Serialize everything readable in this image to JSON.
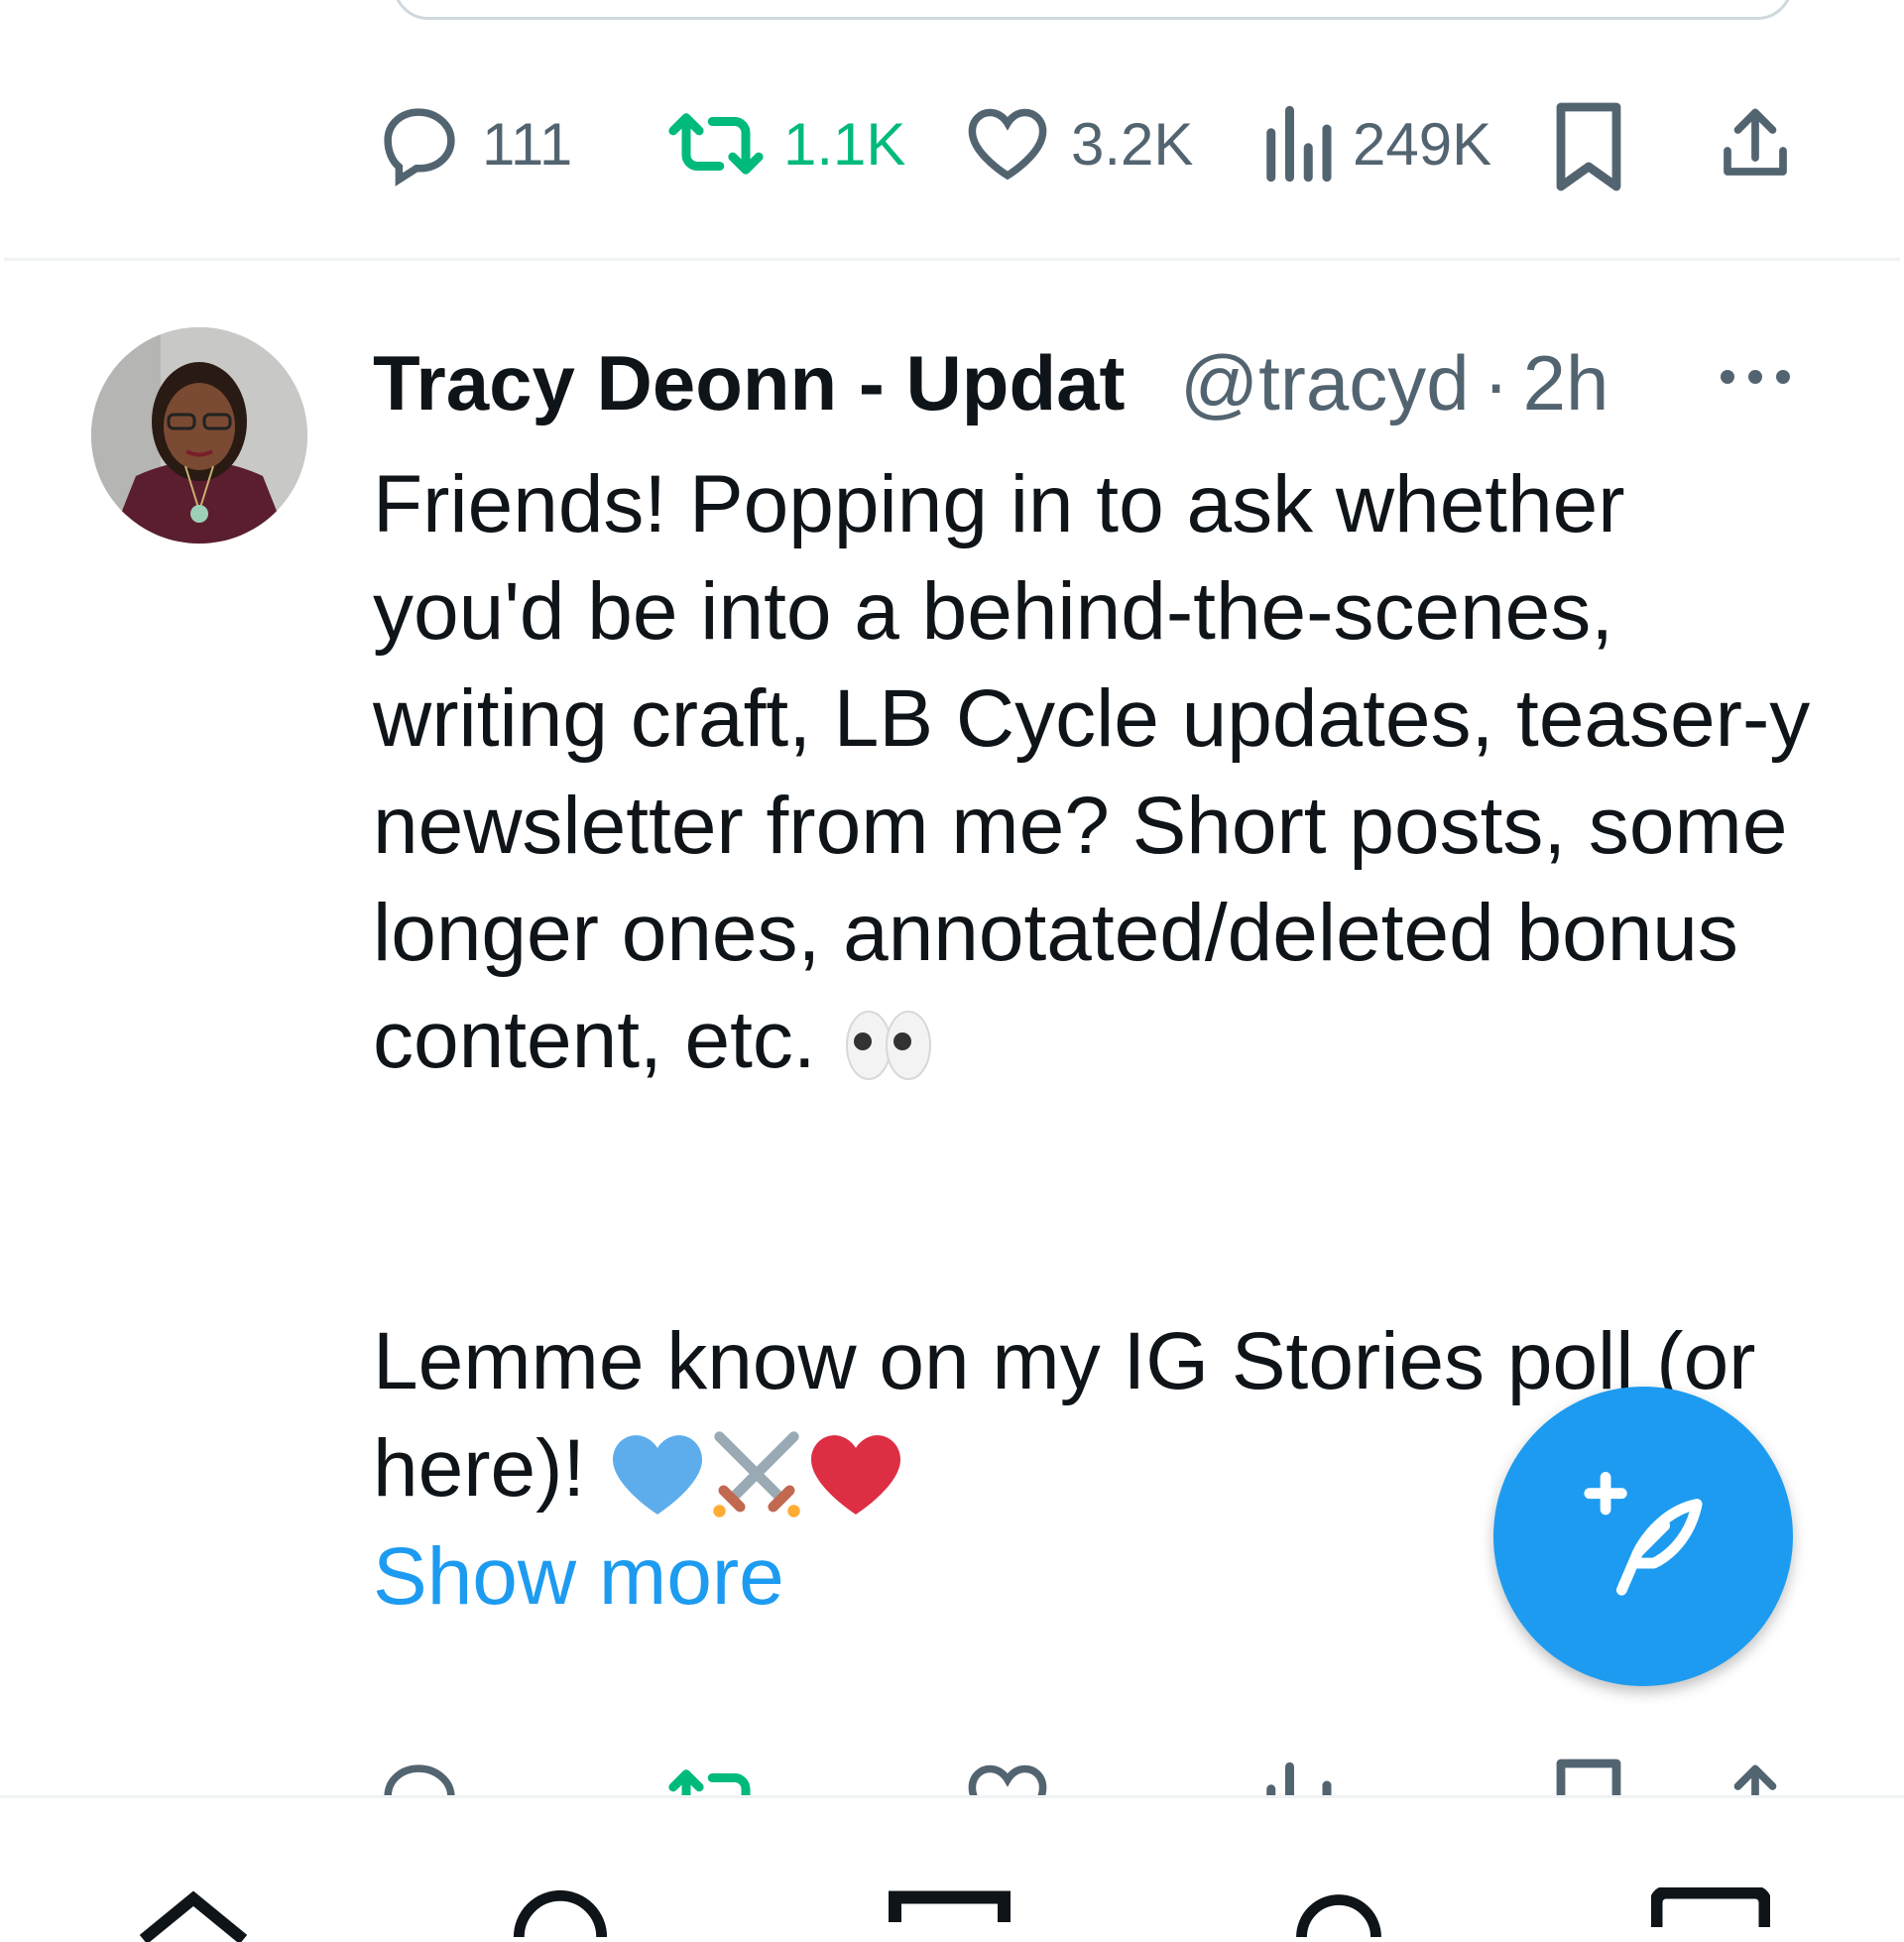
{
  "previous_tweet": {
    "actions": {
      "replies": "111",
      "retweets": "1.1K",
      "likes": "3.2K",
      "views": "249K"
    }
  },
  "tweet": {
    "author_name": "Tracy Deonn - Updat",
    "handle": "@tracyd",
    "separator": "·",
    "time": "2h",
    "paragraph1": "Friends! Popping in to ask whether you'd be into a behind-the-scenes, writing craft, LB Cycle updates, teaser-y newsletter from me? Short posts, some longer ones, annotated/deleted bonus content, etc.",
    "paragraph2": "Lemme know on my IG Stories poll (or here)!",
    "show_more": "Show more",
    "actions": {
      "replies": "",
      "retweets": "",
      "likes": "",
      "views": ""
    }
  },
  "colors": {
    "accent": "#1d9bf0",
    "retweet": "#00ba7c",
    "muted": "#536471",
    "text": "#0f1419"
  },
  "icons": [
    "reply-icon",
    "retweet-icon",
    "like-icon",
    "views-icon",
    "bookmark-icon",
    "share-icon",
    "more-icon",
    "compose-icon",
    "eyes-emoji",
    "blue-heart-emoji",
    "crossed-swords-emoji",
    "red-heart-emoji",
    "home-icon",
    "search-icon",
    "communities-icon",
    "notifications-icon",
    "messages-icon"
  ]
}
